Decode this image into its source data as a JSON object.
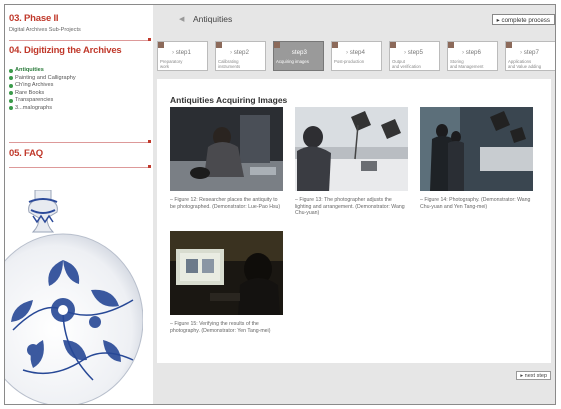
{
  "sidebar": {
    "section1": {
      "title": "03. Phase II",
      "subtitle": "Digital Archives Sub-Projects"
    },
    "section2": {
      "title": "04. Digitizing the Archives",
      "items": [
        {
          "label": "Antiquities",
          "active": true
        },
        {
          "label": "Painting and Calligraphy",
          "active": false
        },
        {
          "label": "Ch'ing Archives",
          "active": false
        },
        {
          "label": "Rare Books",
          "active": false
        },
        {
          "label": "Transparencies",
          "active": false
        },
        {
          "label": "3...malographs",
          "active": false
        }
      ]
    },
    "section3": {
      "title": "05. FAQ"
    }
  },
  "header": {
    "breadcrumb": "Antiquities",
    "complete_process_label": "▸ complete process"
  },
  "steps": [
    {
      "num": "step1",
      "label": "Preparatory\nwork",
      "active": false
    },
    {
      "num": "step2",
      "label": "Calibrating\ninstruments",
      "active": false
    },
    {
      "num": "step3",
      "label": "Acquiring images",
      "active": true
    },
    {
      "num": "step4",
      "label": "Post-production",
      "active": false
    },
    {
      "num": "step5",
      "label": "Output\nand verification",
      "active": false
    },
    {
      "num": "step6",
      "label": "Storing\nand Management",
      "active": false
    },
    {
      "num": "step7",
      "label": "Applications\nand Value adding",
      "active": false
    }
  ],
  "content": {
    "title": "Antiquities Acquiring Images",
    "figures": [
      {
        "caption": "– Figure 12: Researcher places the antiquity to be photographed. (Demonstrator: Lue-Pao Hsu)"
      },
      {
        "caption": "– Figure 13: The photographer adjusts the lighting and arrangement. (Demonstrator: Wang Chu-yuan)"
      },
      {
        "caption": "– Figure 14: Photography. (Demonstrator: Wang Chu-yuan and Yen Tang-mei)"
      },
      {
        "caption": "– Figure 15: Verifying the results of the photography. (Demonstrator: Yen Tang-mei)"
      }
    ],
    "next_step_label": "▸ next step"
  },
  "colors": {
    "accent_red": "#c0392b",
    "active_green": "#3a9a4a",
    "active_step": "#9a9a9a",
    "main_bg": "#e6e6e6"
  }
}
